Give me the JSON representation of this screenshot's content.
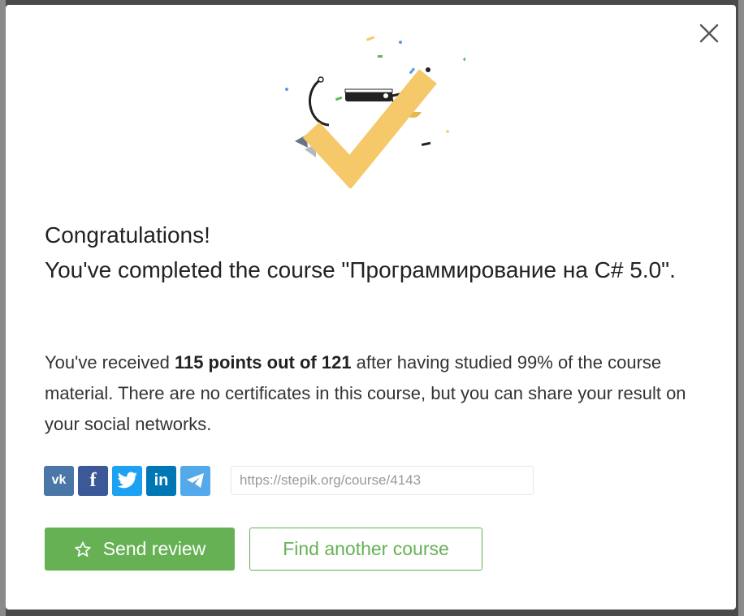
{
  "modal": {
    "title_line1": "Congratulations!",
    "title_line2": "You've completed the course \"Программирование на C# 5.0\".",
    "summary": {
      "prefix": "You've received ",
      "points": "115 points out of 121",
      "suffix": " after having studied 99% of the course material. There are no certificates in this course, but you can share your result on your social networks."
    },
    "share": {
      "icons": [
        "vk-icon",
        "facebook-icon",
        "twitter-icon",
        "linkedin-icon",
        "telegram-icon"
      ],
      "vk_label": "vk",
      "fb_label": "f",
      "li_label": "in",
      "url_value": "https://stepik.org/course/4143"
    },
    "buttons": {
      "send_review": "Send review",
      "find_course": "Find another course"
    },
    "colors": {
      "accent_green": "#66b154",
      "check_yellow": "#f5c96a"
    }
  }
}
